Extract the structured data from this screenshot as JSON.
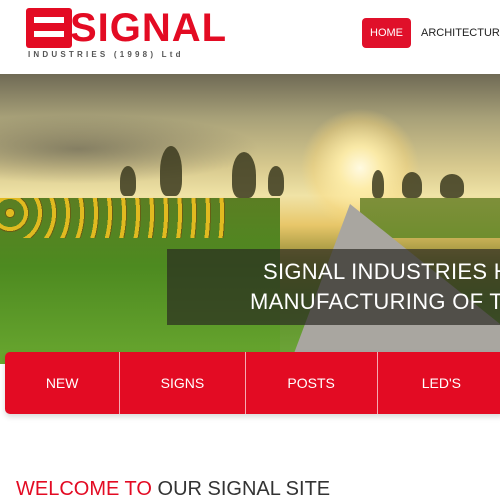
{
  "brand": {
    "name": "SIGNAL",
    "subtitle": "INDUSTRIES (1998) Ltd"
  },
  "nav": {
    "items": [
      {
        "label": "HOME",
        "active": true
      },
      {
        "label": "ARCHITECTURAL",
        "active": false
      }
    ]
  },
  "hero": {
    "caption_line1": "SIGNAL INDUSTRIES HA",
    "caption_line2": "MANUFACTURING OF TR"
  },
  "categories": [
    {
      "label": "NEW"
    },
    {
      "label": "SIGNS"
    },
    {
      "label": "POSTS"
    },
    {
      "label": "LED'S"
    }
  ],
  "welcome": {
    "part1": "WELCOME TO",
    "part2": " OUR SIGNAL SITE"
  },
  "colors": {
    "brand_red": "#e30b23",
    "text_dark": "#333333"
  }
}
